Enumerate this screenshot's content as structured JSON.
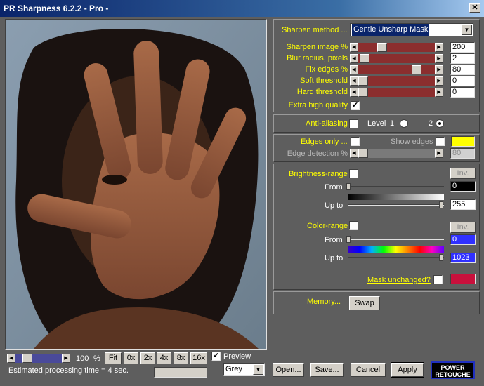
{
  "window": {
    "title": "PR Sharpness 6.2.2 - Pro -"
  },
  "colors": {
    "label_yellow": "#ffff00",
    "slider_red": "#8b2e2e",
    "edge_color": "#ffff00",
    "mask_color": "#c8103c",
    "color_from": "#3030ff",
    "color_upto": "#3030ff"
  },
  "sharpen": {
    "method_label": "Sharpen method ...",
    "method_value": "Gentle Unsharp Mask",
    "rows": [
      {
        "label": "Sharpen image %",
        "value": "200",
        "level": 0.28
      },
      {
        "label": "Blur radius, pixels",
        "value": "2",
        "level": 0.02
      },
      {
        "label": "Fix edges %",
        "value": "80",
        "level": 0.8
      },
      {
        "label": "Soft threshold",
        "value": "0",
        "level": 0
      },
      {
        "label": "Hard threshold",
        "value": "0",
        "level": 0
      }
    ],
    "extra_label": "Extra high quality",
    "extra_checked": "✔"
  },
  "aa": {
    "label": "Anti-aliasing",
    "level_label": "Level",
    "level1": "1",
    "level2": "2"
  },
  "edges": {
    "only_label": "Edges only ...",
    "show_label": "Show edges",
    "detect_label": "Edge detection %",
    "detect_value": "80"
  },
  "brightness": {
    "label": "Brightness-range",
    "inv": "Inv.",
    "from_label": "From",
    "from_value": "0",
    "upto_label": "Up to",
    "upto_value": "255"
  },
  "color_range": {
    "label": "Color-range",
    "inv": "Inv.",
    "from_label": "From",
    "from_value": "0",
    "upto_label": "Up to",
    "upto_value": "1023"
  },
  "mask": {
    "label": "Mask unchanged?"
  },
  "memory": {
    "label": "Memory...",
    "swap": "Swap"
  },
  "bottom": {
    "zoom_value": "100",
    "zoom_unit": "%",
    "zoom_buttons": [
      "Fit",
      "0x",
      "2x",
      "4x",
      "8x",
      "16x"
    ],
    "preview_label": "Preview",
    "preview_checked": "✔",
    "estimate": "Estimated processing time =  4 sec.",
    "channel": "Grey",
    "open": "Open...",
    "save": "Save...",
    "cancel": "Cancel",
    "apply": "Apply",
    "logo_line1": "POWER",
    "logo_line2": "RETOUCHE"
  }
}
